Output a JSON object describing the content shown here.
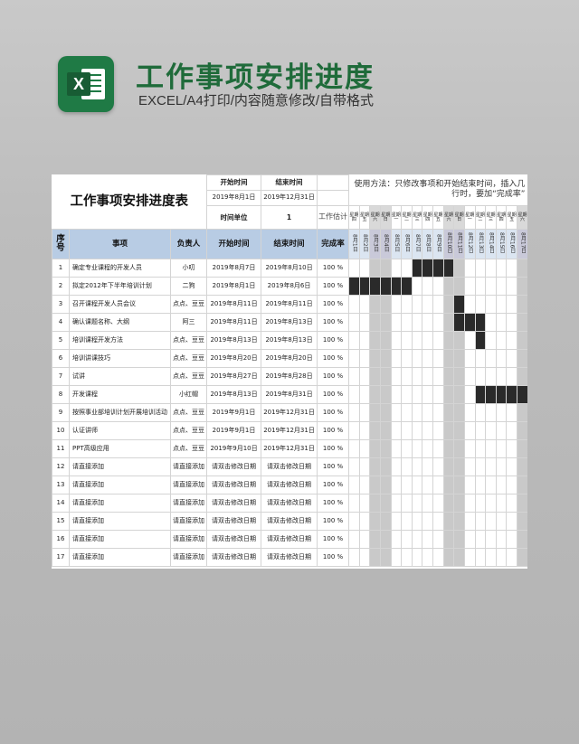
{
  "banner": {
    "title": "工作事项安排进度",
    "subtitle": "EXCEL/A4打印/内容随意修改/自带格式",
    "icon": "excel-icon",
    "icon_letter": "X"
  },
  "sheet": {
    "title": "工作事项安排进度表",
    "start_label": "开始时间",
    "end_label": "结束时间",
    "start_value": "2019年8月1日",
    "end_value": "2019年12月31日",
    "unit_label": "时间单位",
    "unit_value": "1",
    "estimate_label": "工作估计",
    "percent_label": "100%",
    "usage_text": "使用方法：只修改事项和开始结束时间，插入几行时，要加“完成率”",
    "columns": {
      "seq": "序号",
      "task": "事项",
      "owner": "负责人",
      "start": "开始时间",
      "end": "结束时间",
      "rate": "完成率"
    },
    "days": [
      {
        "weekday": "星期四",
        "date": "8月1日"
      },
      {
        "weekday": "星期五",
        "date": "8月2日"
      },
      {
        "weekday": "星期六",
        "date": "8月3日"
      },
      {
        "weekday": "星期日",
        "date": "8月4日"
      },
      {
        "weekday": "星期一",
        "date": "8月5日"
      },
      {
        "weekday": "星期二",
        "date": "8月6日"
      },
      {
        "weekday": "星期三",
        "date": "8月7日"
      },
      {
        "weekday": "星期四",
        "date": "8月8日"
      },
      {
        "weekday": "星期五",
        "date": "8月9日"
      },
      {
        "weekday": "星期六",
        "date": "8月10日"
      },
      {
        "weekday": "星期日",
        "date": "8月11日"
      },
      {
        "weekday": "星期一",
        "date": "8月12日"
      },
      {
        "weekday": "星期二",
        "date": "8月13日"
      },
      {
        "weekday": "星期三",
        "date": "8月14日"
      },
      {
        "weekday": "星期四",
        "date": "8月15日"
      },
      {
        "weekday": "星期五",
        "date": "8月16日"
      },
      {
        "weekday": "星期六",
        "date": "8月17日"
      }
    ],
    "rows": [
      {
        "seq": "1",
        "task": "确定专业课程的开发人员",
        "owner": "小叨",
        "start": "2019年8月7日",
        "end": "2019年8月10日",
        "rate": "100 %"
      },
      {
        "seq": "2",
        "task": "拟定2012年下半年培训计划",
        "owner": "二狗",
        "start": "2019年8月1日",
        "end": "2019年8月6日",
        "rate": "100 %"
      },
      {
        "seq": "3",
        "task": "召开课程开发人员会议",
        "owner": "点点、豆豆",
        "start": "2019年8月11日",
        "end": "2019年8月11日",
        "rate": "100 %"
      },
      {
        "seq": "4",
        "task": "确认课题名称、大纲",
        "owner": "阿三",
        "start": "2019年8月11日",
        "end": "2019年8月13日",
        "rate": "100 %"
      },
      {
        "seq": "5",
        "task": "培训课程开发方法",
        "owner": "点点、豆豆",
        "start": "2019年8月13日",
        "end": "2019年8月13日",
        "rate": "100 %"
      },
      {
        "seq": "6",
        "task": "培训讲课技巧",
        "owner": "点点、豆豆",
        "start": "2019年8月20日",
        "end": "2019年8月20日",
        "rate": "100 %"
      },
      {
        "seq": "7",
        "task": "试讲",
        "owner": "点点、豆豆",
        "start": "2019年8月27日",
        "end": "2019年8月28日",
        "rate": "100 %"
      },
      {
        "seq": "8",
        "task": "开发课程",
        "owner": "小红帽",
        "start": "2019年8月13日",
        "end": "2019年8月31日",
        "rate": "100 %"
      },
      {
        "seq": "9",
        "task": "按照事业部培训计划开展培训活动",
        "owner": "点点、豆豆",
        "start": "2019年9月1日",
        "end": "2019年12月31日",
        "rate": "100 %"
      },
      {
        "seq": "10",
        "task": "认证讲师",
        "owner": "点点、豆豆",
        "start": "2019年9月1日",
        "end": "2019年12月31日",
        "rate": "100 %"
      },
      {
        "seq": "11",
        "task": "PPT高级应用",
        "owner": "点点、豆豆",
        "start": "2019年9月10日",
        "end": "2019年12月31日",
        "rate": "100 %"
      },
      {
        "seq": "12",
        "task": "请直接添加",
        "owner": "请直接添加",
        "start": "请双击修改日期",
        "end": "请双击修改日期",
        "rate": "100 %"
      },
      {
        "seq": "13",
        "task": "请直接添加",
        "owner": "请直接添加",
        "start": "请双击修改日期",
        "end": "请双击修改日期",
        "rate": "100 %"
      },
      {
        "seq": "14",
        "task": "请直接添加",
        "owner": "请直接添加",
        "start": "请双击修改日期",
        "end": "请双击修改日期",
        "rate": "100 %"
      },
      {
        "seq": "15",
        "task": "请直接添加",
        "owner": "请直接添加",
        "start": "请双击修改日期",
        "end": "请双击修改日期",
        "rate": "100 %"
      },
      {
        "seq": "16",
        "task": "请直接添加",
        "owner": "请直接添加",
        "start": "请双击修改日期",
        "end": "请双击修改日期",
        "rate": "100 %"
      },
      {
        "seq": "17",
        "task": "请直接添加",
        "owner": "请直接添加",
        "start": "请双击修改日期",
        "end": "请双击修改日期",
        "rate": "100 %"
      }
    ],
    "colors": {
      "header_fill": "#b8cce4",
      "gantt_bar": "#2a2a2a",
      "weekend_fill": "#c9c9c9",
      "brand_green": "#1f7a45"
    }
  }
}
